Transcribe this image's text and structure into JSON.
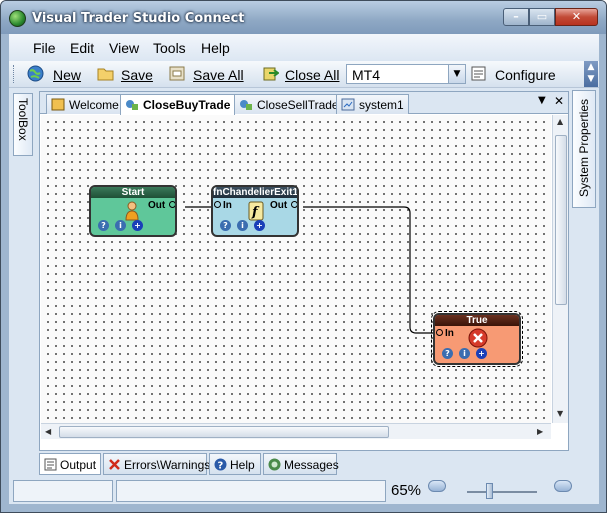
{
  "window": {
    "title": "Visual Trader Studio Connect",
    "min": "–",
    "max": "▭",
    "close": "✕"
  },
  "menu": [
    "File",
    "Edit",
    "View",
    "Tools",
    "Help"
  ],
  "toolbar": {
    "new_label": "New",
    "save_label": "Save",
    "save_all_label": "Save All",
    "close_all_label": "Close All",
    "platform_value": "MT4",
    "configure_label": "Configure"
  },
  "side_panels": {
    "toolbox": "ToolBox",
    "properties": "System Properties"
  },
  "tabs": [
    {
      "label": "Welcome",
      "active": false
    },
    {
      "label": "CloseBuyTrade",
      "active": true
    },
    {
      "label": "CloseSellTrade",
      "active": false
    },
    {
      "label": "system1",
      "active": false
    }
  ],
  "nodes": {
    "start": {
      "title": "Start",
      "out": "Out"
    },
    "function": {
      "title": "fnChandelierExit1",
      "in": "In",
      "out": "Out"
    },
    "true_node": {
      "title": "True",
      "in": "In"
    }
  },
  "bottom_tabs": [
    {
      "label": "Output"
    },
    {
      "label": "Errors\\Warnings"
    },
    {
      "label": "Help"
    },
    {
      "label": "Messages"
    }
  ],
  "status": {
    "zoom": "65%"
  },
  "colors": {
    "start_node": "#5fc79a",
    "function_node": "#a9d8e6",
    "true_node": "#f79a74",
    "connector": "#000000"
  }
}
